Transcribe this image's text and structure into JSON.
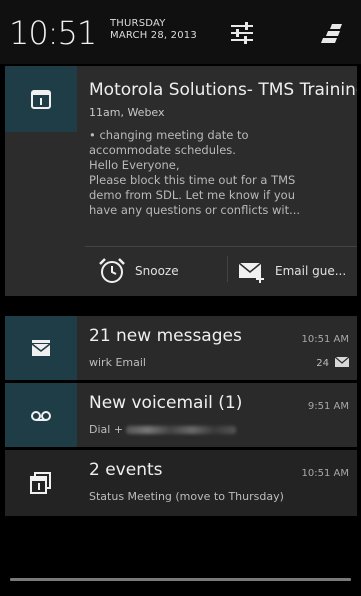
{
  "status": {
    "time": "10:51",
    "day": "THURSDAY",
    "date": "MARCH 28, 2013"
  },
  "icons": {
    "settings": "sliders-icon",
    "clear": "clear-all-icon"
  },
  "notifications": [
    {
      "icon": "calendar-icon",
      "title": "Motorola Solutions- TMS Training",
      "subtitle": "11am, Webex",
      "body": "• changing meeting date to\naccommodate schedules.\nHello Everyone,\nPlease block this time out for a TMS\ndemo from SDL.   Let me know if you\nhave any questions or conflicts wit...",
      "actions": [
        {
          "icon": "alarm-clock-icon",
          "label": "Snooze"
        },
        {
          "icon": "email-icon",
          "label": "Email gue..."
        }
      ]
    },
    {
      "icon": "email-stack-icon",
      "title": "21 new messages",
      "subtitle": "wirk Email",
      "time": "10:51 AM",
      "count": "24"
    },
    {
      "icon": "voicemail-icon",
      "title": "New voicemail (1)",
      "subtitle": "Dial +",
      "time": "9:51 AM"
    },
    {
      "icon": "calendar-stack-icon",
      "title": "2 events",
      "subtitle": "Status Meeting (move to Thursday)",
      "time": "10:51 AM"
    }
  ]
}
